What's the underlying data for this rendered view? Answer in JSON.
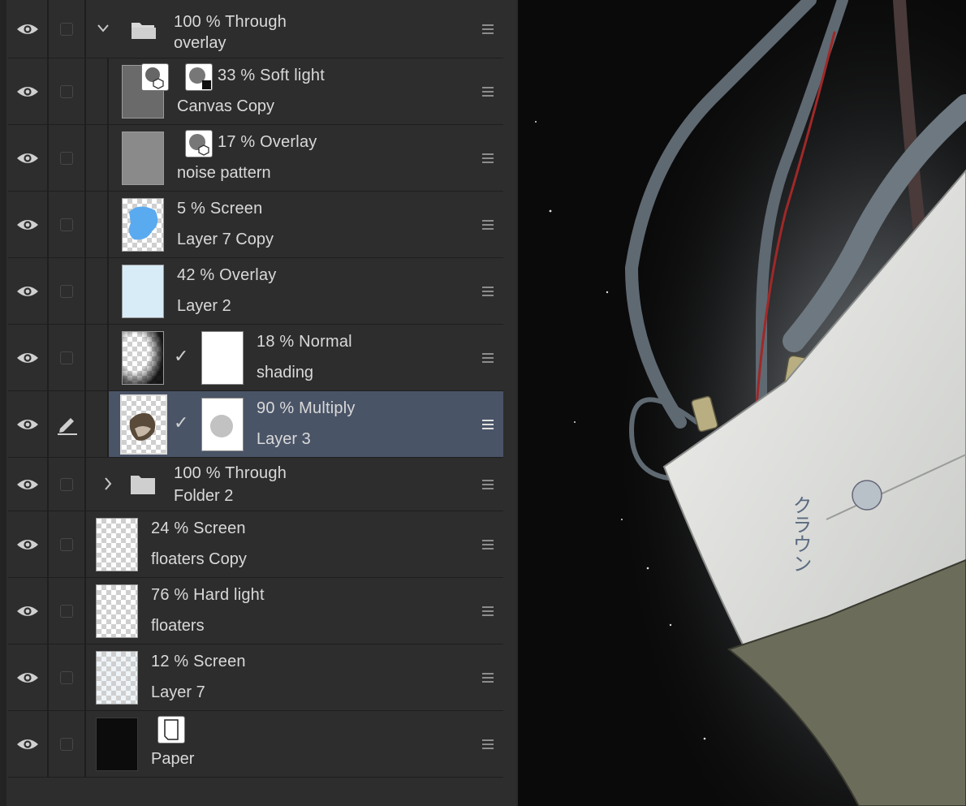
{
  "layers": [
    {
      "id": "l0",
      "opacity": "100 %",
      "blend": "Through",
      "name": "overlay",
      "kind": "folder-open"
    },
    {
      "id": "l1",
      "opacity": "33 %",
      "blend": "Soft light",
      "name": "Canvas Copy",
      "kind": "layer"
    },
    {
      "id": "l2",
      "opacity": "17 %",
      "blend": "Overlay",
      "name": "noise pattern",
      "kind": "layer"
    },
    {
      "id": "l3",
      "opacity": "5 %",
      "blend": "Screen",
      "name": "Layer 7 Copy",
      "kind": "layer"
    },
    {
      "id": "l4",
      "opacity": "42 %",
      "blend": "Overlay",
      "name": "Layer 2",
      "kind": "layer"
    },
    {
      "id": "l5",
      "opacity": "18 %",
      "blend": "Normal",
      "name": "shading",
      "kind": "layer"
    },
    {
      "id": "l6",
      "opacity": "90 %",
      "blend": "Multiply",
      "name": "Layer 3",
      "kind": "layer",
      "selected": true
    },
    {
      "id": "l7",
      "opacity": "100 %",
      "blend": "Through",
      "name": "Folder 2",
      "kind": "folder-closed"
    },
    {
      "id": "l8",
      "opacity": "24 %",
      "blend": "Screen",
      "name": "floaters Copy",
      "kind": "layer"
    },
    {
      "id": "l9",
      "opacity": "76 %",
      "blend": "Hard light",
      "name": "floaters",
      "kind": "layer"
    },
    {
      "id": "l10",
      "opacity": "12 %",
      "blend": "Screen",
      "name": "Layer 7",
      "kind": "layer"
    },
    {
      "id": "l11",
      "opacity": "",
      "blend": "",
      "name": "Paper",
      "kind": "paper"
    }
  ],
  "canvas_text": "クラウン",
  "colors": {
    "panel": "#2d2d2d",
    "selected": "#4a5467",
    "canvas": "#0a0a0a"
  }
}
